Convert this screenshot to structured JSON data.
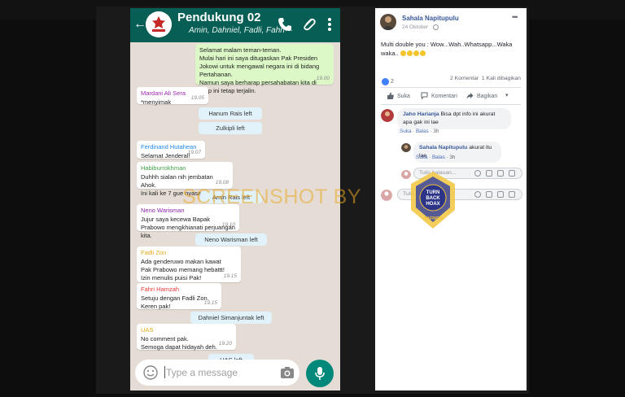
{
  "whatsapp": {
    "title": "Pendukung 02",
    "members": "Amin, Dahniel, Fadli, Fahri···",
    "messages": [
      {
        "type": "out",
        "text": "Selamat malam teman-teman.\nMulai hari ini saya ditugaskan Pak Presiden Jokowi untuk mengawal negara ini di bidang Pertahanan.\nNamun saya berharap persahabatan kita di grup ini tetap terjalin.",
        "time": "19.00"
      },
      {
        "type": "in",
        "sender": "Mardani Ali Sera",
        "sender_color": "#9c27b0",
        "text": "*menyimak",
        "time": "19.05"
      },
      {
        "type": "system",
        "text": "Hanum Rais left"
      },
      {
        "type": "system",
        "text": "Zulkipli left"
      },
      {
        "type": "in",
        "sender": "Ferdinand Hutahean",
        "sender_color": "#1e88e5",
        "text": "Selamat Jenderal!",
        "time": "19.07"
      },
      {
        "type": "in",
        "sender": "Habiburrokhman",
        "sender_color": "#43a047",
        "text": "Duhhh sialan nih jembatan Ahok.\nIni kali ke 7 gue nyasar!",
        "time": "19.08"
      },
      {
        "type": "system",
        "text": "Amin Rais left"
      },
      {
        "type": "in",
        "sender": "Neno Warisman",
        "sender_color": "#8e24aa",
        "text": "Jujur saya kecewa Bapak Prabowo mengkhianati perjuangan kita.",
        "time": "19.10"
      },
      {
        "type": "system",
        "text": "Neno Warisman left"
      },
      {
        "type": "in",
        "sender": "Fadli Zon",
        "sender_color": "#e6a817",
        "text": "Ada genderuwo makan kawat\nPak Prabowo memang hebattt!\nIzin menulis puisi Pak!",
        "time": "19.15"
      },
      {
        "type": "in",
        "sender": "Fahri Hamzah",
        "sender_color": "#e53935",
        "text": "Setuju dengan Fadli Zon.\nKeren pak!",
        "time": "19.15"
      },
      {
        "type": "system",
        "text": "Dahniel Simanjuntak left"
      },
      {
        "type": "in",
        "sender": "UAS",
        "sender_color": "#e6a817",
        "text": "No comment pak.\nSemoga dapat hidayah deh.",
        "time": "19.20"
      },
      {
        "type": "system",
        "text": "UAS left"
      }
    ],
    "input_placeholder": "Type a message"
  },
  "facebook": {
    "author": "Sahala Napitupulu",
    "date": "24 Oktober",
    "post_text": "Multi double you : Wow...Wah..Whatsapp...Waka waka..",
    "reaction_count": "2",
    "comment_count": "2 Komentar",
    "share_count": "1 Kali dibagikan",
    "actions": {
      "like": "Suka",
      "comment": "Komentari",
      "share": "Bagikan"
    },
    "comments": [
      {
        "name": "Jaho Harianja",
        "text": "Bisa dpt info ini akurat apa gak ini lae",
        "like": "Suka",
        "reply": "Balas",
        "age": "3h"
      },
      {
        "name": "Sahala Napitupulu",
        "text": "akurat itu lae",
        "like": "Suka",
        "reply": "Balas",
        "age": "3h"
      }
    ],
    "reply_placeholder": "Tulis balasan...",
    "comment_placeholder": "Tulis komentar..."
  },
  "watermark": {
    "text": "SCREENSHOT BY",
    "seal_lines": [
      "TURN",
      "BACK",
      "HOAX"
    ],
    "seal_ring": "MASYARAKAT ANTI FITNAH INDONESIA",
    "seal_bottom": "MAFINDO"
  },
  "colors": {
    "wa_header": "#075e54",
    "wa_bg": "#e5ddd5",
    "wa_out": "#dcf8c6",
    "wa_system": "#e1f2fb",
    "fb_link": "#385898",
    "watermark": "#e9a822"
  }
}
